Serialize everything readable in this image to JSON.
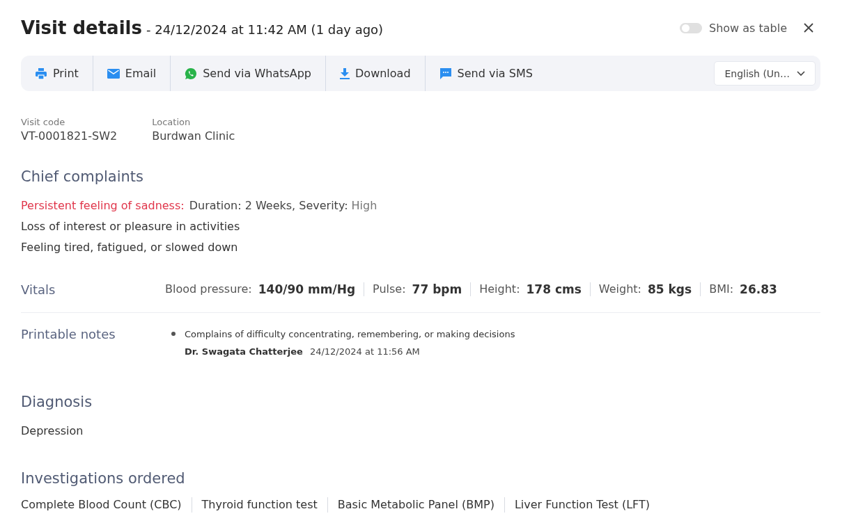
{
  "header": {
    "title": "Visit details",
    "subtitle": "- 24/12/2024 at 11:42 AM (1 day ago)",
    "table_toggle": {
      "label": "Show as table",
      "on": false
    }
  },
  "toolbar": {
    "actions": [
      {
        "kind": "print",
        "label": "Print"
      },
      {
        "kind": "email",
        "label": "Email"
      },
      {
        "kind": "whatsapp",
        "label": "Send via WhatsApp"
      },
      {
        "kind": "download",
        "label": "Download"
      },
      {
        "kind": "sms",
        "label": "Send via SMS"
      }
    ],
    "language": {
      "value": "English (Un…"
    }
  },
  "info": [
    {
      "label": "Visit code",
      "value": "VT-0001821-SW2"
    },
    {
      "label": "Location",
      "value": "Burdwan Clinic"
    }
  ],
  "chief_complaints": {
    "heading": "Chief complaints",
    "items": [
      {
        "name": "Persistent feeling of sadness:",
        "flagged": true,
        "details": "Duration: 2 Weeks, Severity:",
        "severity": "High"
      },
      {
        "name": "Loss of interest or pleasure in activities",
        "flagged": false
      },
      {
        "name": "Feeling tired, fatigued, or slowed down",
        "flagged": false
      }
    ]
  },
  "vitals": {
    "label": "Vitals",
    "items": [
      {
        "label": "Blood pressure:",
        "value": "140/90 mm/Hg"
      },
      {
        "label": "Pulse:",
        "value": "77 bpm"
      },
      {
        "label": "Height:",
        "value": "178 cms"
      },
      {
        "label": "Weight:",
        "value": "85 kgs"
      },
      {
        "label": "BMI:",
        "value": "26.83"
      }
    ]
  },
  "printable_notes": {
    "label": "Printable notes",
    "notes": [
      {
        "text": "Complains of difficulty concentrating, remembering, or making decisions",
        "author": "Dr. Swagata Chatterjee",
        "time": "24/12/2024 at 11:56 AM"
      }
    ]
  },
  "diagnosis": {
    "heading": "Diagnosis",
    "items": [
      "Depression"
    ]
  },
  "investigations": {
    "heading": "Investigations ordered",
    "items": [
      "Complete Blood Count (CBC)",
      "Thyroid function test",
      "Basic Metabolic Panel (BMP)",
      "Liver Function Test (LFT)"
    ]
  }
}
